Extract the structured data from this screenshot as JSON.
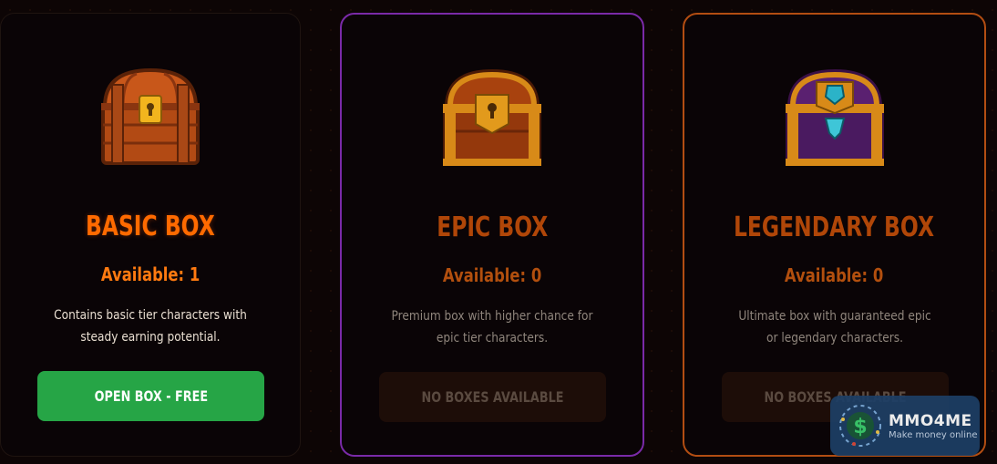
{
  "cards": [
    {
      "title": "BASIC BOX",
      "available": "Available: 1",
      "description": "Contains basic tier characters with steady earning potential.",
      "button_label": "OPEN BOX - FREE",
      "button_enabled": true
    },
    {
      "title": "EPIC BOX",
      "available": "Available: 0",
      "description": "Premium box with higher chance for epic tier characters.",
      "button_label": "NO BOXES AVAILABLE",
      "button_enabled": false
    },
    {
      "title": "LEGENDARY BOX",
      "available": "Available: 0",
      "description": "Ultimate box with guaranteed epic or legendary characters.",
      "button_label": "NO BOXES AVAILABLE",
      "button_enabled": false
    }
  ],
  "colors": {
    "accent_orange": "#ff6a00",
    "epic_border": "#7a2aa8",
    "legendary_border": "#b24d12",
    "button_green": "#26a546"
  },
  "watermark": {
    "name": "MMO4ME",
    "tagline": "Make money online"
  }
}
